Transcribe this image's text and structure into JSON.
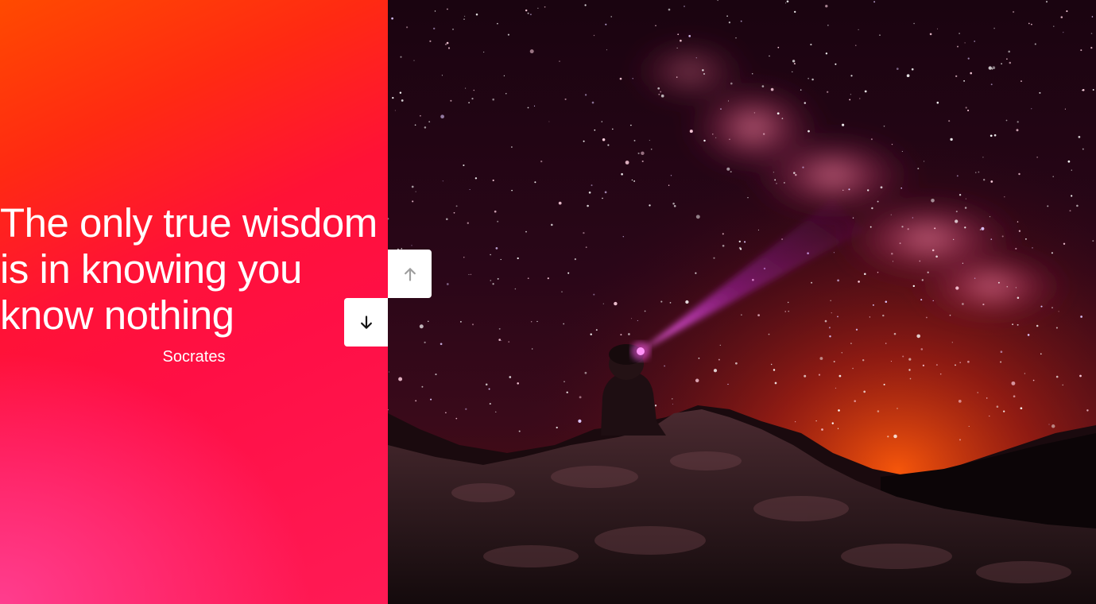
{
  "slide": {
    "quote": "The only true wisdom is in knowing you know nothing",
    "author": "Socrates"
  },
  "controls": {
    "up_icon": "arrow-up-icon",
    "down_icon": "arrow-down-icon",
    "up_color": "#9e9e9e",
    "down_color": "#111111"
  },
  "image": {
    "subject": "person-with-headlamp-under-milky-way"
  },
  "colors": {
    "gradient_top": "#ff4a00",
    "gradient_mid": "#ff1236",
    "gradient_bottom_left": "#ff3d8e"
  }
}
